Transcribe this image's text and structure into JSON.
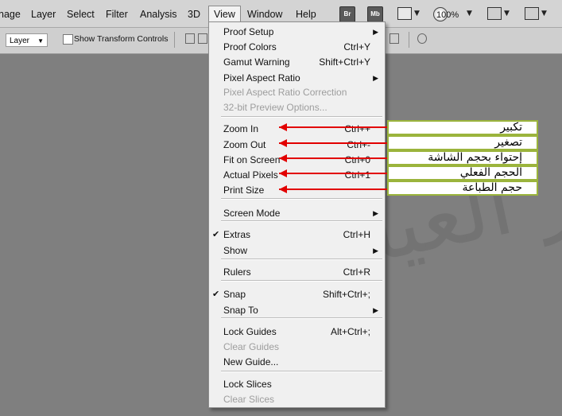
{
  "menubar": {
    "items": [
      "nage",
      "Layer",
      "Select",
      "Filter",
      "Analysis",
      "3D",
      "View",
      "Window",
      "Help"
    ],
    "active": "View",
    "bridge_button": "Br",
    "minibridge_button": "Mb",
    "zoom_level": "100%"
  },
  "options": {
    "layer_select": "Layer",
    "show_transform_controls": "Show Transform Controls",
    "show_transform_checked": false
  },
  "menu": {
    "items": [
      {
        "label": "Proof Setup",
        "shortcut": "",
        "submenu": true,
        "disabled": false,
        "checked": false
      },
      {
        "label": "Proof Colors",
        "shortcut": "Ctrl+Y",
        "submenu": false,
        "disabled": false,
        "checked": false
      },
      {
        "label": "Gamut Warning",
        "shortcut": "Shift+Ctrl+Y",
        "submenu": false,
        "disabled": false,
        "checked": false
      },
      {
        "label": "Pixel Aspect Ratio",
        "shortcut": "",
        "submenu": true,
        "disabled": false,
        "checked": false
      },
      {
        "label": "Pixel Aspect Ratio Correction",
        "shortcut": "",
        "submenu": false,
        "disabled": true,
        "checked": false
      },
      {
        "label": "32-bit Preview Options...",
        "shortcut": "",
        "submenu": false,
        "disabled": true,
        "checked": false
      },
      {
        "label": "Zoom In",
        "shortcut": "Ctrl++",
        "submenu": false,
        "disabled": false,
        "checked": false
      },
      {
        "label": "Zoom Out",
        "shortcut": "Ctrl+-",
        "submenu": false,
        "disabled": false,
        "checked": false
      },
      {
        "label": "Fit on Screen",
        "shortcut": "Ctrl+0",
        "submenu": false,
        "disabled": false,
        "checked": false
      },
      {
        "label": "Actual Pixels",
        "shortcut": "Ctrl+1",
        "submenu": false,
        "disabled": false,
        "checked": false
      },
      {
        "label": "Print Size",
        "shortcut": "",
        "submenu": false,
        "disabled": false,
        "checked": false
      },
      {
        "label": "Screen Mode",
        "shortcut": "",
        "submenu": true,
        "disabled": false,
        "checked": false
      },
      {
        "label": "Extras",
        "shortcut": "Ctrl+H",
        "submenu": false,
        "disabled": false,
        "checked": true
      },
      {
        "label": "Show",
        "shortcut": "",
        "submenu": true,
        "disabled": false,
        "checked": false
      },
      {
        "label": "Rulers",
        "shortcut": "Ctrl+R",
        "submenu": false,
        "disabled": false,
        "checked": false
      },
      {
        "label": "Snap",
        "shortcut": "Shift+Ctrl+;",
        "submenu": false,
        "disabled": false,
        "checked": true
      },
      {
        "label": "Snap To",
        "shortcut": "",
        "submenu": true,
        "disabled": false,
        "checked": false
      },
      {
        "label": "Lock Guides",
        "shortcut": "Alt+Ctrl+;",
        "submenu": false,
        "disabled": false,
        "checked": false
      },
      {
        "label": "Clear Guides",
        "shortcut": "",
        "submenu": false,
        "disabled": true,
        "checked": false
      },
      {
        "label": "New Guide...",
        "shortcut": "",
        "submenu": false,
        "disabled": false,
        "checked": false
      },
      {
        "label": "Lock Slices",
        "shortcut": "",
        "submenu": false,
        "disabled": false,
        "checked": false
      },
      {
        "label": "Clear Slices",
        "shortcut": "",
        "submenu": false,
        "disabled": true,
        "checked": false
      }
    ]
  },
  "annotations": [
    "تكبير",
    "تصغير",
    "إحتواء بحجم الشاشة",
    "الحجم الفعلي",
    "حجم الطباعة"
  ],
  "watermark": "سمير العيادي",
  "colors": {
    "annotation_border": "#9bb43c",
    "arrow": "#e20000",
    "canvas": "#7f7f7f"
  }
}
